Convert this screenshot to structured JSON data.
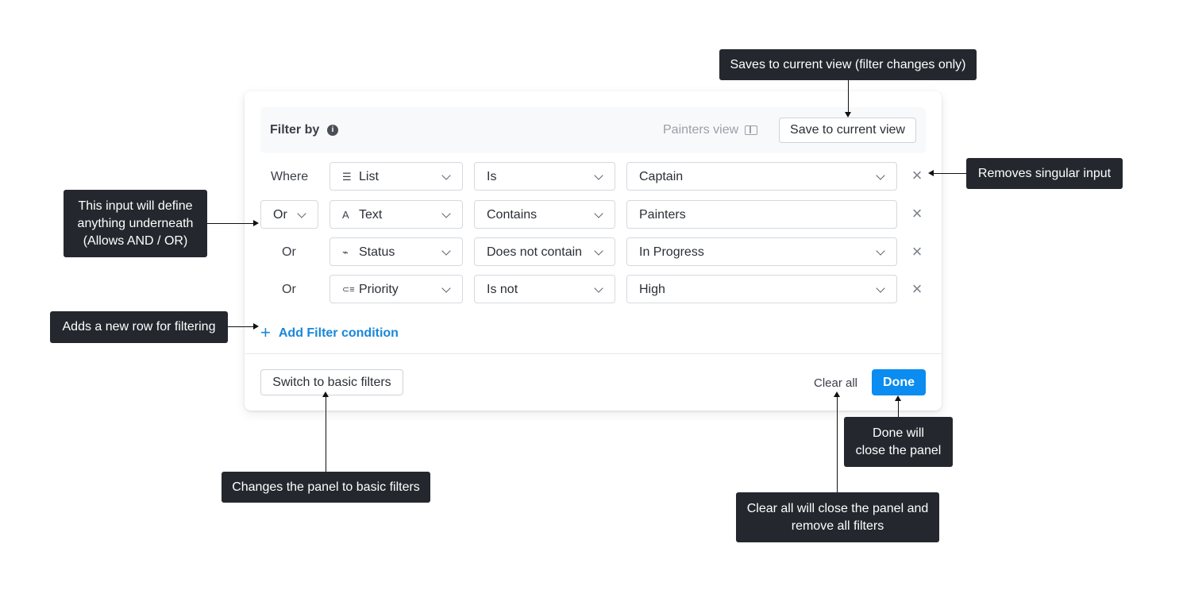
{
  "panel": {
    "header": {
      "title": "Filter by",
      "info_icon": "info-icon",
      "view_name": "Painters view",
      "view_icon": "book-icon",
      "save_label": "Save to current view"
    },
    "rows": [
      {
        "conjunction": "Where",
        "field_icon": "list-icon",
        "field_glyph": "☰",
        "field": "List",
        "operator": "Is",
        "value": "Captain",
        "value_dropdown": true
      },
      {
        "conjunction": "Or",
        "conjunction_dropdown": true,
        "field_icon": "text-icon",
        "field_glyph": "A",
        "field": "Text",
        "operator": "Contains",
        "value": "Painters",
        "value_dropdown": false
      },
      {
        "conjunction": "Or",
        "field_icon": "status-icon",
        "field_glyph": "⌁",
        "field": "Status",
        "operator": "Does not contain",
        "value": "In Progress",
        "value_dropdown": true
      },
      {
        "conjunction": "Or",
        "field_icon": "priority-icon",
        "field_glyph": "⊂≡",
        "field": "Priority",
        "operator": "Is not",
        "value": "High",
        "value_dropdown": true
      }
    ],
    "add_condition_label": "Add Filter condition",
    "footer": {
      "basic_label": "Switch to basic filters",
      "clear_label": "Clear all",
      "done_label": "Done"
    },
    "accent_color": "#0a8cf0"
  },
  "annotations": {
    "save_view": "Saves to current view (filter changes only)",
    "remove_input": "Removes singular input",
    "conjunction": "This input will define\nanything underneath\n(Allows AND / OR)",
    "add_row": "Adds a new row for filtering",
    "basic_filters": "Changes the panel to basic filters",
    "done": "Done will\nclose the panel",
    "clear_all": "Clear all will close the panel and\nremove all filters"
  }
}
